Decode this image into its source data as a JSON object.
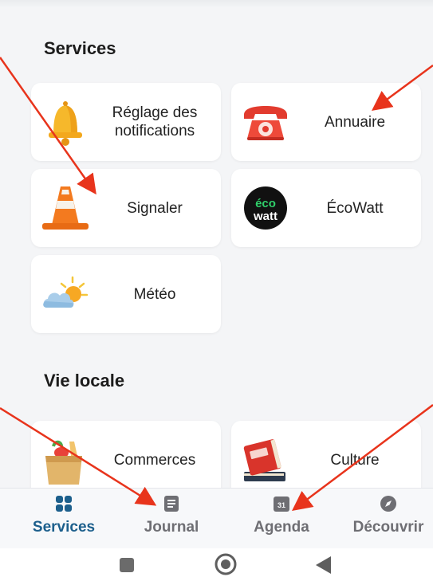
{
  "sections": {
    "services": "Services",
    "vie_locale": "Vie locale"
  },
  "services": [
    {
      "label": "Réglage des\nnotifications",
      "icon": "bell-icon"
    },
    {
      "label": "Annuaire",
      "icon": "telephone-icon"
    },
    {
      "label": "Signaler",
      "icon": "traffic-cone-icon"
    },
    {
      "label": "ÉcoWatt",
      "icon": "ecowatt-logo-icon",
      "logo_text": "éco watt"
    },
    {
      "label": "Météo",
      "icon": "weather-icon"
    }
  ],
  "vie_locale": [
    {
      "label": "Commerces",
      "icon": "shopping-bag-icon"
    },
    {
      "label": "Culture",
      "icon": "books-icon"
    }
  ],
  "bottom_nav": {
    "items": [
      {
        "label": "Services",
        "icon": "grid-icon",
        "active": true
      },
      {
        "label": "Journal",
        "icon": "newspaper-icon",
        "active": false
      },
      {
        "label": "Agenda",
        "icon": "calendar-icon",
        "active": false,
        "badge": "31"
      },
      {
        "label": "Découvrir",
        "icon": "compass-icon",
        "active": false
      }
    ]
  },
  "system_nav": [
    "stop-square-icon",
    "home-circle-icon",
    "back-triangle-icon"
  ],
  "colors": {
    "active": "#1c5f8c",
    "inactive": "#6e6e73",
    "annotation_arrow": "#e8341c",
    "background": "#f4f5f7"
  }
}
